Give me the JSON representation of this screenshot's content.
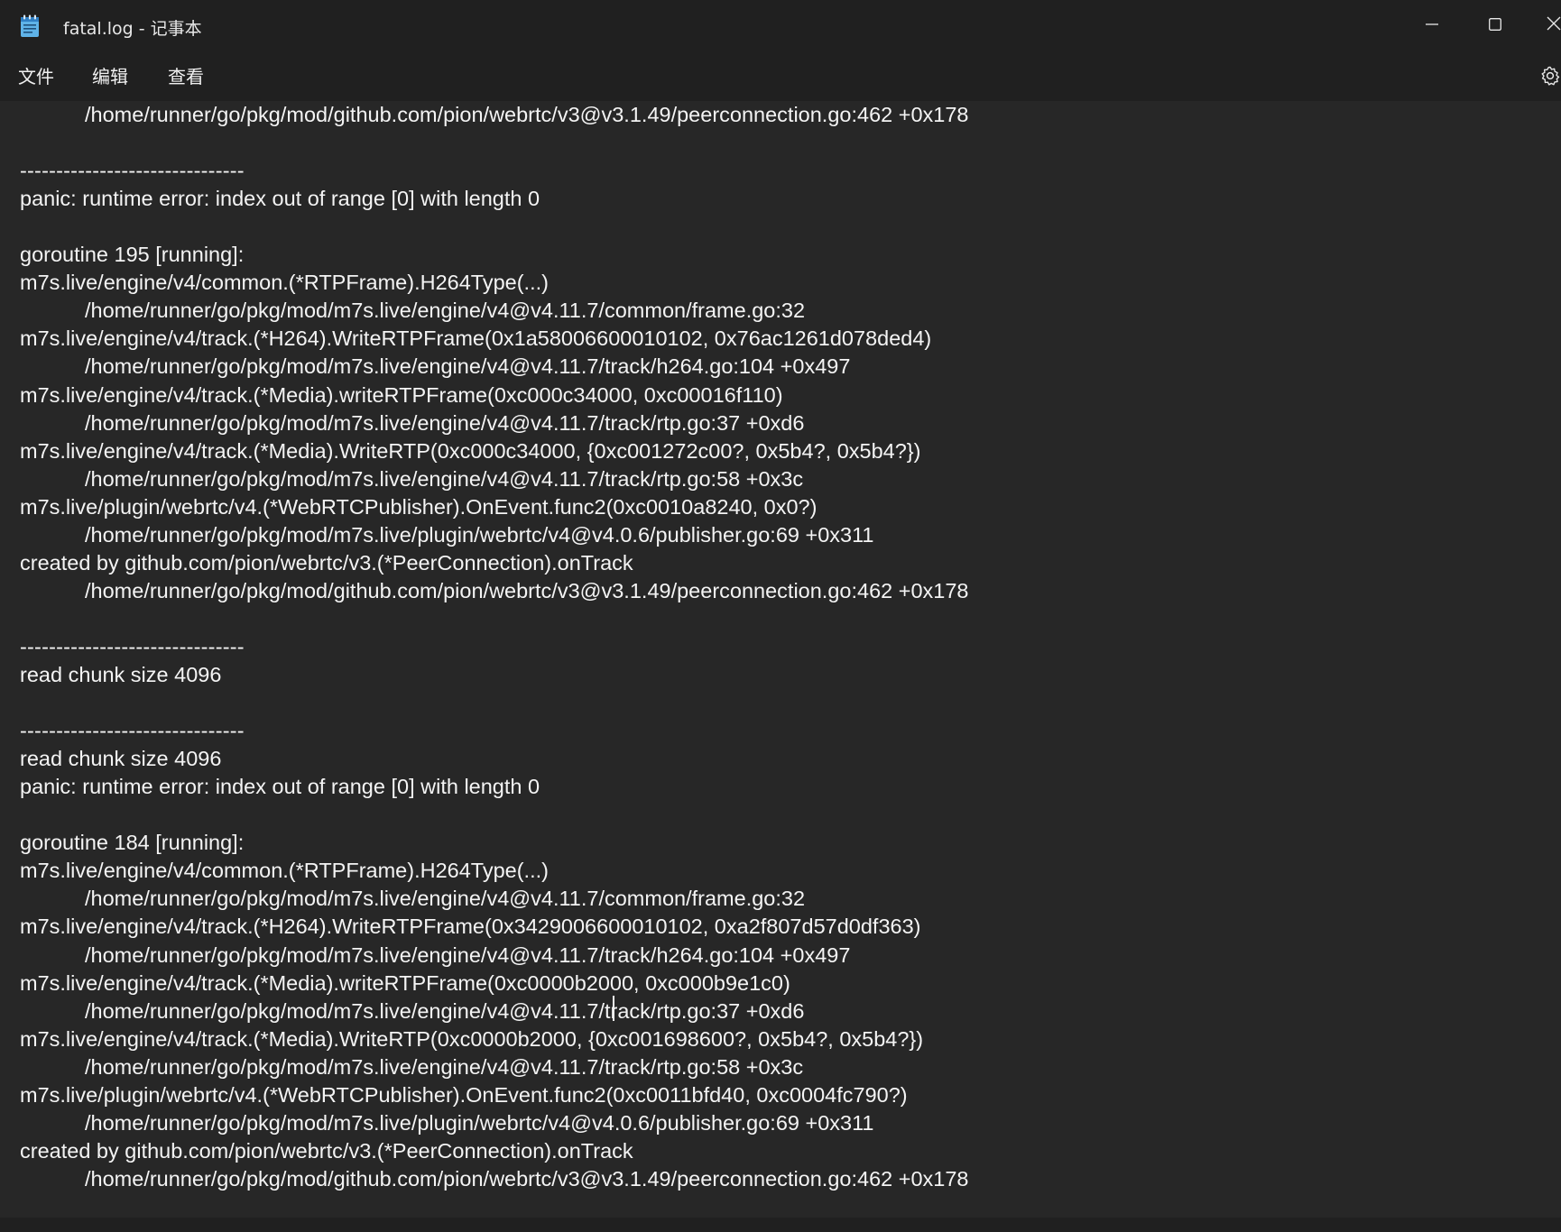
{
  "window": {
    "title": "fatal.log - 记事本",
    "app_icon": "notepad-icon",
    "controls": [
      "minimize-icon",
      "maximize-icon",
      "close-icon"
    ]
  },
  "menu": {
    "items": [
      "文件",
      "编辑",
      "查看"
    ],
    "settings_icon": "gear-icon"
  },
  "editor": {
    "lines": [
      {
        "text": "/home/runner/go/pkg/mod/github.com/pion/webrtc/v3@v3.1.49/peerconnection.go:462 +0x178",
        "indent": true
      },
      {
        "text": "",
        "indent": false
      },
      {
        "text": "-------------------------------",
        "indent": false
      },
      {
        "text": "panic: runtime error: index out of range [0] with length 0",
        "indent": false
      },
      {
        "text": "",
        "indent": false
      },
      {
        "text": "goroutine 195 [running]:",
        "indent": false
      },
      {
        "text": "m7s.live/engine/v4/common.(*RTPFrame).H264Type(...)",
        "indent": false
      },
      {
        "text": "/home/runner/go/pkg/mod/m7s.live/engine/v4@v4.11.7/common/frame.go:32",
        "indent": true
      },
      {
        "text": "m7s.live/engine/v4/track.(*H264).WriteRTPFrame(0x1a58006600010102, 0x76ac1261d078ded4)",
        "indent": false
      },
      {
        "text": "/home/runner/go/pkg/mod/m7s.live/engine/v4@v4.11.7/track/h264.go:104 +0x497",
        "indent": true
      },
      {
        "text": "m7s.live/engine/v4/track.(*Media).writeRTPFrame(0xc000c34000, 0xc00016f110)",
        "indent": false
      },
      {
        "text": "/home/runner/go/pkg/mod/m7s.live/engine/v4@v4.11.7/track/rtp.go:37 +0xd6",
        "indent": true
      },
      {
        "text": "m7s.live/engine/v4/track.(*Media).WriteRTP(0xc000c34000, {0xc001272c00?, 0x5b4?, 0x5b4?})",
        "indent": false
      },
      {
        "text": "/home/runner/go/pkg/mod/m7s.live/engine/v4@v4.11.7/track/rtp.go:58 +0x3c",
        "indent": true
      },
      {
        "text": "m7s.live/plugin/webrtc/v4.(*WebRTCPublisher).OnEvent.func2(0xc0010a8240, 0x0?)",
        "indent": false
      },
      {
        "text": "/home/runner/go/pkg/mod/m7s.live/plugin/webrtc/v4@v4.0.6/publisher.go:69 +0x311",
        "indent": true
      },
      {
        "text": "created by github.com/pion/webrtc/v3.(*PeerConnection).onTrack",
        "indent": false
      },
      {
        "text": "/home/runner/go/pkg/mod/github.com/pion/webrtc/v3@v3.1.49/peerconnection.go:462 +0x178",
        "indent": true
      },
      {
        "text": "",
        "indent": false
      },
      {
        "text": "-------------------------------",
        "indent": false
      },
      {
        "text": "read chunk size 4096",
        "indent": false
      },
      {
        "text": "",
        "indent": false
      },
      {
        "text": "-------------------------------",
        "indent": false
      },
      {
        "text": "read chunk size 4096",
        "indent": false
      },
      {
        "text": "panic: runtime error: index out of range [0] with length 0",
        "indent": false
      },
      {
        "text": "",
        "indent": false
      },
      {
        "text": "goroutine 184 [running]:",
        "indent": false
      },
      {
        "text": "m7s.live/engine/v4/common.(*RTPFrame).H264Type(...)",
        "indent": false
      },
      {
        "text": "/home/runner/go/pkg/mod/m7s.live/engine/v4@v4.11.7/common/frame.go:32",
        "indent": true
      },
      {
        "text": "m7s.live/engine/v4/track.(*H264).WriteRTPFrame(0x3429006600010102, 0xa2f807d57d0df363)",
        "indent": false
      },
      {
        "text": "/home/runner/go/pkg/mod/m7s.live/engine/v4@v4.11.7/track/h264.go:104 +0x497",
        "indent": true
      },
      {
        "text": "m7s.live/engine/v4/track.(*Media).writeRTPFrame(0xc0000b2000, 0xc000b9e1c0)",
        "indent": false
      },
      {
        "text": "/home/runner/go/pkg/mod/m7s.live/engine/v4@v4.11.7/track/rtp.go:37 +0xd6",
        "indent": true
      },
      {
        "text": "m7s.live/engine/v4/track.(*Media).WriteRTP(0xc0000b2000, {0xc001698600?, 0x5b4?, 0x5b4?})",
        "indent": false
      },
      {
        "text": "/home/runner/go/pkg/mod/m7s.live/engine/v4@v4.11.7/track/rtp.go:58 +0x3c",
        "indent": true
      },
      {
        "text": "m7s.live/plugin/webrtc/v4.(*WebRTCPublisher).OnEvent.func2(0xc0011bfd40, 0xc0004fc790?)",
        "indent": false
      },
      {
        "text": "/home/runner/go/pkg/mod/m7s.live/plugin/webrtc/v4@v4.0.6/publisher.go:69 +0x311",
        "indent": true
      },
      {
        "text": "created by github.com/pion/webrtc/v3.(*PeerConnection).onTrack",
        "indent": false
      },
      {
        "text": "/home/runner/go/pkg/mod/github.com/pion/webrtc/v3@v3.1.49/peerconnection.go:462 +0x178",
        "indent": true
      }
    ]
  },
  "colors": {
    "background": "#272727",
    "chrome": "#202020",
    "text": "#f4f4f4"
  }
}
